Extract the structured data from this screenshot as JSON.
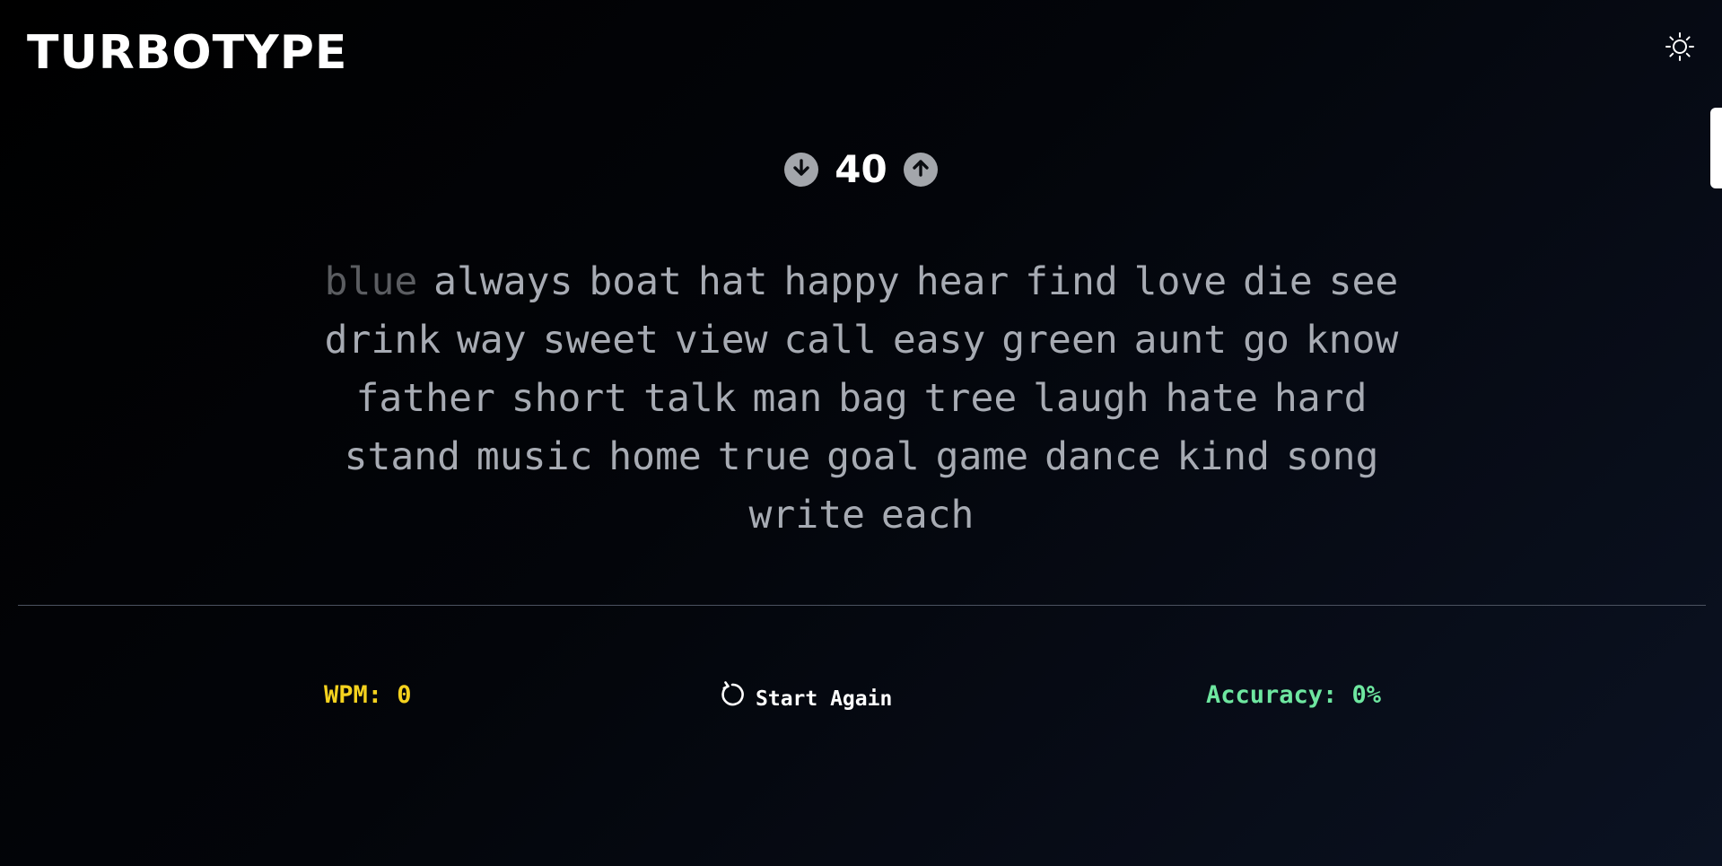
{
  "header": {
    "logo": "TURBOTYPE",
    "theme_icon": "sun-icon"
  },
  "counter": {
    "value": "40",
    "decrease_icon": "arrow-down-circle-icon",
    "increase_icon": "arrow-up-circle-icon"
  },
  "words": [
    {
      "text": "blue",
      "typed": true
    },
    {
      "text": "always",
      "typed": false
    },
    {
      "text": "boat",
      "typed": false
    },
    {
      "text": "hat",
      "typed": false
    },
    {
      "text": "happy",
      "typed": false
    },
    {
      "text": "hear",
      "typed": false
    },
    {
      "text": "find",
      "typed": false
    },
    {
      "text": "love",
      "typed": false
    },
    {
      "text": "die",
      "typed": false
    },
    {
      "text": "see",
      "typed": false
    },
    {
      "text": "drink",
      "typed": false
    },
    {
      "text": "way",
      "typed": false
    },
    {
      "text": "sweet",
      "typed": false
    },
    {
      "text": "view",
      "typed": false
    },
    {
      "text": "call",
      "typed": false
    },
    {
      "text": "easy",
      "typed": false
    },
    {
      "text": "green",
      "typed": false
    },
    {
      "text": "aunt",
      "typed": false
    },
    {
      "text": "go",
      "typed": false
    },
    {
      "text": "know",
      "typed": false
    },
    {
      "text": "father",
      "typed": false
    },
    {
      "text": "short",
      "typed": false
    },
    {
      "text": "talk",
      "typed": false
    },
    {
      "text": "man",
      "typed": false
    },
    {
      "text": "bag",
      "typed": false
    },
    {
      "text": "tree",
      "typed": false
    },
    {
      "text": "laugh",
      "typed": false
    },
    {
      "text": "hate",
      "typed": false
    },
    {
      "text": "hard",
      "typed": false
    },
    {
      "text": "stand",
      "typed": false
    },
    {
      "text": "music",
      "typed": false
    },
    {
      "text": "home",
      "typed": false
    },
    {
      "text": "true",
      "typed": false
    },
    {
      "text": "goal",
      "typed": false
    },
    {
      "text": "game",
      "typed": false
    },
    {
      "text": "dance",
      "typed": false
    },
    {
      "text": "kind",
      "typed": false
    },
    {
      "text": "song",
      "typed": false
    },
    {
      "text": "write",
      "typed": false
    },
    {
      "text": "each",
      "typed": false
    }
  ],
  "stats": {
    "wpm": "WPM: 0",
    "restart_label": "Start Again",
    "restart_icon": "refresh-icon",
    "accuracy": "Accuracy: 0%"
  },
  "colors": {
    "wpm": "#f5d21e",
    "accuracy": "#6ee7a0",
    "pending_word": "#a7abb3",
    "typed_word": "#5b5d61"
  }
}
